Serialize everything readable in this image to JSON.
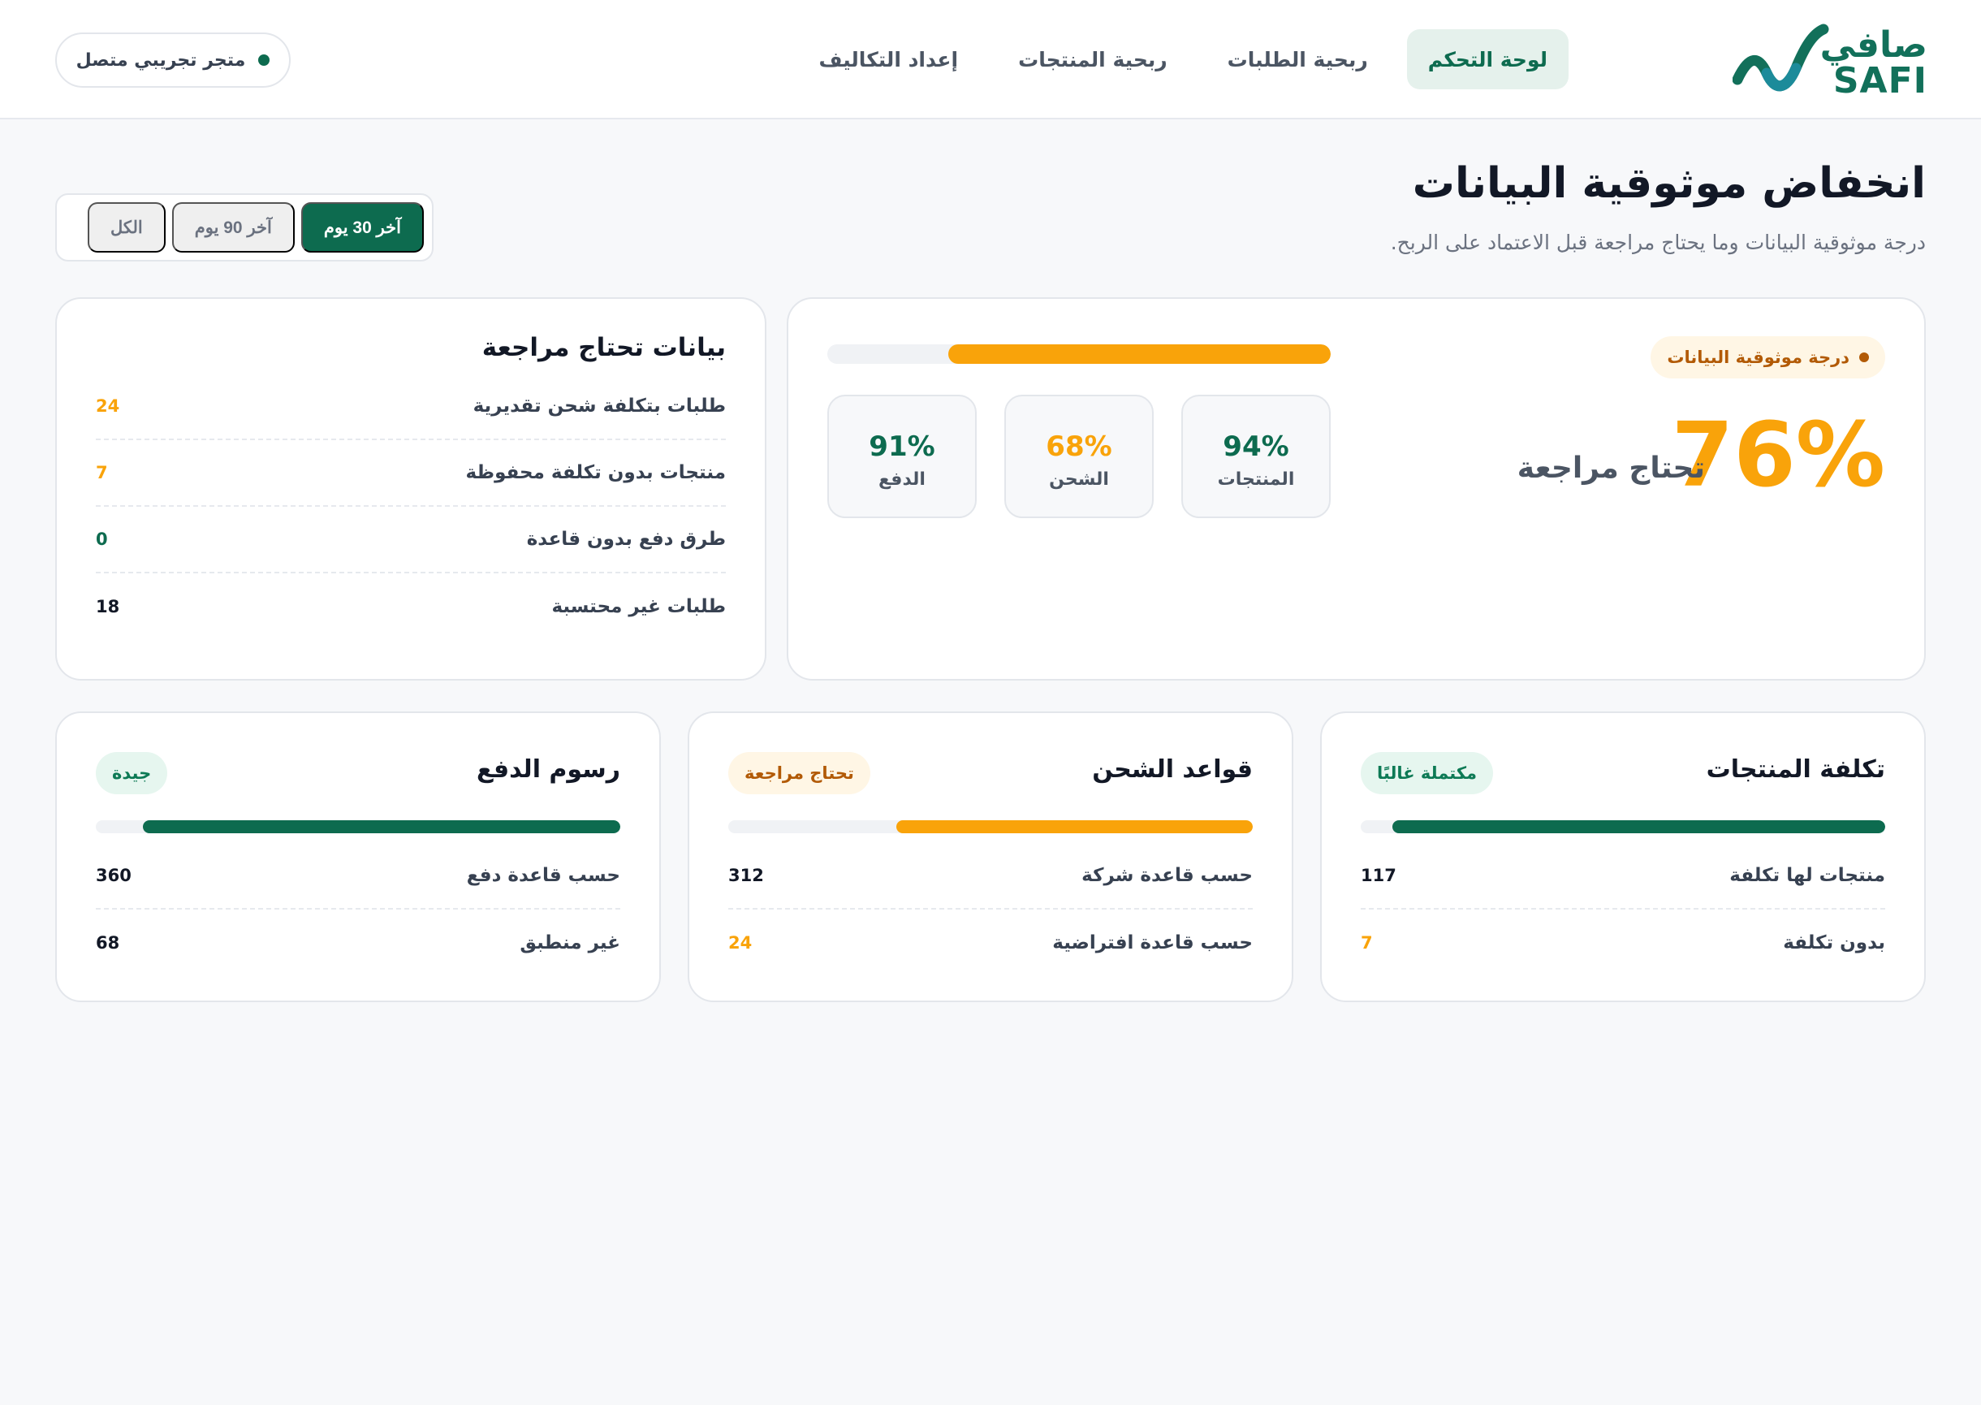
{
  "colors": {
    "brand": "#0d6b4f",
    "warning": "#f9a30a",
    "text_dark": "#121826",
    "page_bg": "#f7f8fa"
  },
  "brand": {
    "name_ar": "صافي",
    "name_en": "SAFI",
    "icon": "wave-logo-icon"
  },
  "nav": {
    "items": [
      {
        "label": "لوحة التحكم",
        "active": true
      },
      {
        "label": "ربحية الطلبات",
        "active": false
      },
      {
        "label": "ربحية المنتجات",
        "active": false
      },
      {
        "label": "إعداد التكاليف",
        "active": false
      }
    ]
  },
  "store": {
    "label": "متجر تجريبي متصل",
    "status_color": "#0d6b4f"
  },
  "page": {
    "title": "انخفاض موثوقية البيانات",
    "subtitle": "درجة موثوقية البيانات وما يحتاج مراجعة قبل الاعتماد على الربح."
  },
  "range": {
    "options": [
      {
        "label": "آخر 30 يوم",
        "active": true
      },
      {
        "label": "آخر 90 يوم",
        "active": false
      },
      {
        "label": "الكل",
        "active": false
      }
    ]
  },
  "score_card": {
    "badge": "درجة موثوقية البيانات",
    "value": "76%",
    "status": "تحتاج مراجعة",
    "progress": 0.76,
    "stats": [
      {
        "value": "94%",
        "label": "المنتجات",
        "color": "#0d6b4f"
      },
      {
        "value": "68%",
        "label": "الشحن",
        "color": "#f9a30a"
      },
      {
        "value": "91%",
        "label": "الدفع",
        "color": "#0d6b4f"
      }
    ]
  },
  "review_card": {
    "title": "بيانات تحتاج مراجعة",
    "rows": [
      {
        "label": "طلبات بتكلفة شحن تقديرية",
        "value": "24",
        "color": "#f9a30a"
      },
      {
        "label": "منتجات بدون تكلفة محفوظة",
        "value": "7",
        "color": "#f9a30a"
      },
      {
        "label": "طرق دفع بدون قاعدة",
        "value": "0",
        "color": "#0d6b4f"
      },
      {
        "label": "طلبات غير محتسبة",
        "value": "18",
        "color": "#121826"
      }
    ]
  },
  "mini_cards": [
    {
      "title": "تكلفة المنتجات",
      "badge": "مكتملة غالبًا",
      "badge_type": "good",
      "progress": 0.94,
      "bar_color": "#0d6b4f",
      "rows": [
        {
          "label": "منتجات لها تكلفة",
          "value": "117",
          "color": "#121826"
        },
        {
          "label": "بدون تكلفة",
          "value": "7",
          "color": "#f9a30a"
        }
      ]
    },
    {
      "title": "قواعد الشحن",
      "badge": "تحتاج مراجعة",
      "badge_type": "warn",
      "progress": 0.68,
      "bar_color": "#f9a30a",
      "rows": [
        {
          "label": "حسب قاعدة شركة",
          "value": "312",
          "color": "#121826"
        },
        {
          "label": "حسب قاعدة افتراضية",
          "value": "24",
          "color": "#f9a30a"
        }
      ]
    },
    {
      "title": "رسوم الدفع",
      "badge": "جيدة",
      "badge_type": "good",
      "progress": 0.91,
      "bar_color": "#0d6b4f",
      "rows": [
        {
          "label": "حسب قاعدة دفع",
          "value": "360",
          "color": "#121826"
        },
        {
          "label": "غير منطبق",
          "value": "68",
          "color": "#121826"
        }
      ]
    }
  ]
}
